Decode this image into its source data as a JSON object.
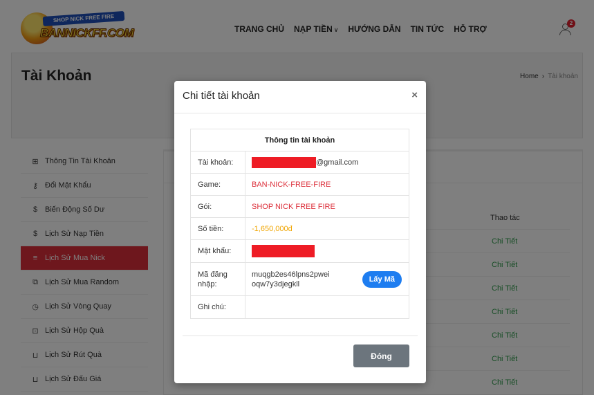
{
  "header": {
    "logo_badge": "SHOP NICK FREE FIRE",
    "logo_brand": "BANNICKFF.COM",
    "nav": [
      {
        "label": "TRANG CHỦ"
      },
      {
        "label": "NẠP TIỀN"
      },
      {
        "label": "HƯỚNG DẪN"
      },
      {
        "label": "TIN TỨC"
      },
      {
        "label": "HỖ TRỢ"
      }
    ],
    "notification_count": "2"
  },
  "page": {
    "title": "Tài Khoản",
    "breadcrumb": {
      "home": "Home",
      "sep": "›",
      "current": "Tài khoản"
    }
  },
  "sidebar": {
    "items": [
      {
        "label": "Thông Tin Tài Khoản",
        "icon": "grid-icon"
      },
      {
        "label": "Đổi Mật Khẩu",
        "icon": "key-icon"
      },
      {
        "label": "Biến Động Số Dư",
        "icon": "dollar-icon"
      },
      {
        "label": "Lịch Sử Nạp Tiền",
        "icon": "dollar-icon"
      },
      {
        "label": "Lịch Sử Mua Nick",
        "icon": "list-icon",
        "active": true
      },
      {
        "label": "Lịch Sử Mua Random",
        "icon": "layers-icon"
      },
      {
        "label": "Lịch Sử Vòng Quay",
        "icon": "clock-icon"
      },
      {
        "label": "Lịch Sử Hộp Quà",
        "icon": "gift-icon"
      },
      {
        "label": "Lịch Sử Rút Quà",
        "icon": "cart-icon"
      },
      {
        "label": "Lịch Sử Đấu Giá",
        "icon": "cart-icon"
      }
    ]
  },
  "table": {
    "action_header": "Thao tác",
    "detail_label": "Chi Tiết"
  },
  "modal": {
    "title": "Chi tiết tài khoản",
    "close_symbol": "×",
    "caption": "Thông tin tài khoản",
    "rows": {
      "account_label": "Tài khoản:",
      "account_suffix": "@gmail.com",
      "game_label": "Game:",
      "game_value": "BAN-NICK-FREE-FIRE",
      "pack_label": "Gói:",
      "pack_value": "SHOP NICK FREE FIRE",
      "amount_label": "Số tiền:",
      "amount_value": "-1,650,000đ",
      "password_label": "Mật khẩu:",
      "code_label": "Mã đăng nhập:",
      "code_value": "muqgb2es46lpns2pwei oqw7y3djegkll",
      "copy_button": "Lấy Mã",
      "note_label": "Ghi chú:"
    },
    "footer_button": "Đóng"
  },
  "colors": {
    "accent_red": "#dc2f3a",
    "link_green": "#2e9b4b",
    "amount_gold": "#f0a500",
    "button_blue": "#1e7df0",
    "button_gray": "#6c757d",
    "mask_red": "#ee1c25"
  }
}
